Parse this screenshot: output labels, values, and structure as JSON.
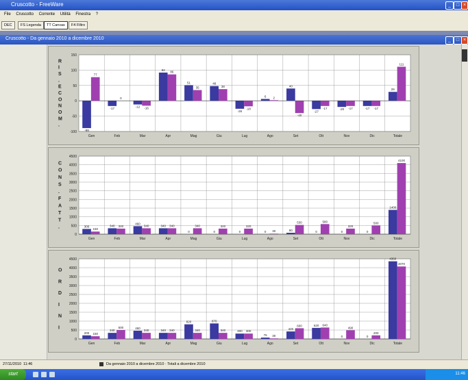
{
  "app_title": "Cruscotto - FreeWare",
  "menu": [
    "File",
    "Cruscotto",
    "Corrente",
    "Utilità",
    "Finestra",
    "?"
  ],
  "toolbar": [
    "DEC",
    "FS Legenda",
    "TT Canvas",
    "F4 Filtro"
  ],
  "child_title": "Cruscotto - Da gennaio 2010 a dicembre 2010",
  "status": {
    "date": "27/11/2010",
    "time": "11:46",
    "period": "Da gennaio 2010 a dicembre 2010 · Totali a dicembre 2010"
  },
  "taskbar": {
    "start": "start",
    "clock": "11:46"
  },
  "colors": {
    "series_a": "#3a3aa0",
    "series_b": "#a040b0"
  },
  "months": [
    "Gen",
    "Feb",
    "Mar",
    "Apr",
    "Mag",
    "Giu",
    "Lug",
    "Ago",
    "Set",
    "Ott",
    "Nov",
    "Dic",
    "Totale"
  ],
  "chart_data": [
    {
      "type": "bar",
      "ylabel": "RIS. ECONOM.",
      "ylim": [
        -100,
        150
      ],
      "yticks": [
        "150",
        "100",
        "50",
        "0",
        "-50",
        "-100"
      ],
      "tick_values": [
        150,
        100,
        50,
        0,
        -50,
        -100
      ],
      "series": [
        {
          "values": [
            -89,
            -17,
            -12,
            92,
            51,
            48,
            -26,
            6,
            40,
            -27,
            -20,
            -17,
            29
          ]
        },
        {
          "values": [
            77,
            0,
            -16,
            86,
            35,
            38,
            -18,
            2,
            -40,
            -17,
            -17,
            -17,
            111
          ]
        }
      ],
      "labels": [
        [
          "-89",
          "-17",
          "-12",
          "92",
          "51",
          "48",
          "-26",
          "6",
          "40",
          "-27",
          "-20",
          "-17",
          "29"
        ],
        [
          "77",
          "0",
          "-16",
          "86",
          "35",
          "38",
          "-18",
          "2",
          "-40",
          "-17",
          "-17",
          "-17",
          "111"
        ]
      ]
    },
    {
      "type": "bar",
      "ylabel": "CONS. FATT.",
      "ylim": [
        0,
        4500
      ],
      "yticks": [
        "4500",
        "4000",
        "3500",
        "3000",
        "2500",
        "2000",
        "1500",
        "1000",
        "500",
        "0"
      ],
      "tick_values": [
        4500,
        4000,
        3500,
        3000,
        2500,
        2000,
        1500,
        1000,
        500,
        0
      ],
      "series": [
        {
          "values": [
            300,
            340,
            460,
            340,
            0,
            0,
            0,
            0,
            80,
            0,
            0,
            0,
            1400
          ]
        },
        {
          "values": [
            150,
            320,
            340,
            340,
            340,
            320,
            320,
            30,
            530,
            580,
            320,
            500,
            4100
          ]
        }
      ],
      "labels": [
        [
          "300",
          "340",
          "460",
          "340",
          "0",
          "0",
          "0",
          "0",
          "80",
          "0",
          "0",
          "0",
          "1400"
        ],
        [
          "150",
          "320",
          "340",
          "340",
          "340",
          "320",
          "320",
          "30",
          "530",
          "580",
          "320",
          "500",
          "4100"
        ]
      ]
    },
    {
      "type": "bar",
      "ylabel": "ORDINI",
      "ylim": [
        0,
        4500
      ],
      "yticks": [
        "4500",
        "4000",
        "3500",
        "3000",
        "2500",
        "2000",
        "1500",
        "1000",
        "500",
        "0"
      ],
      "tick_values": [
        4500,
        4000,
        3500,
        3000,
        2500,
        2000,
        1500,
        1000,
        500,
        0
      ],
      "series": [
        {
          "values": [
            200,
            340,
            460,
            340,
            820,
            870,
            300,
            75,
            420,
            620,
            0,
            0,
            4360
          ]
        },
        {
          "values": [
            150,
            500,
            340,
            340,
            340,
            340,
            300,
            30,
            600,
            640,
            490,
            200,
            4070
          ]
        }
      ],
      "labels": [
        [
          "200",
          "340",
          "460",
          "340",
          "820",
          "870",
          "300",
          "75",
          "420",
          "620",
          "0",
          "0",
          "4360"
        ],
        [
          "150",
          "500",
          "340",
          "340",
          "340",
          "340",
          "300",
          "30",
          "600",
          "640",
          "490",
          "200",
          "4070"
        ]
      ]
    }
  ]
}
